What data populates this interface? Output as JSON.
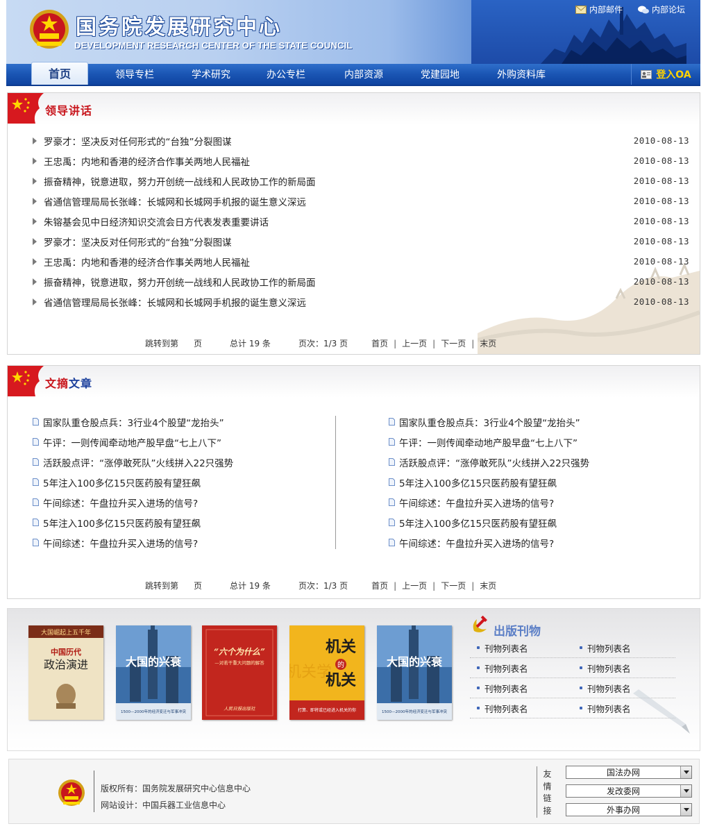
{
  "header": {
    "title": "国务院发展研究中心",
    "subtitle": "DEVELOPMENT RESEARCH CENTER OF THE STATE COUNCIL",
    "top_links": [
      {
        "icon": "mail-icon",
        "label": "内部邮件"
      },
      {
        "icon": "forum-icon",
        "label": "内部论坛"
      }
    ]
  },
  "nav": {
    "items": [
      "首页",
      "领导专栏",
      "学术研究",
      "办公专栏",
      "内部资源",
      "党建园地",
      "外购资料库"
    ],
    "active_index": 0,
    "login_label": "登入OA"
  },
  "leaders": {
    "title_a": "领导",
    "title_b": "讲话",
    "items": [
      {
        "title": "罗豪才：坚决反对任何形式的“台独”分裂图谋",
        "date": "2010-08-13"
      },
      {
        "title": "王忠禹：内地和香港的经济合作事关两地人民福祉",
        "date": "2010-08-13"
      },
      {
        "title": "振奋精神，锐意进取，努力开创统一战线和人民政协工作的新局面",
        "date": "2010-08-13"
      },
      {
        "title": "省通信管理局局长张峰：长城网和长城网手机报的诞生意义深远",
        "date": "2010-08-13"
      },
      {
        "title": "朱镕基会见中日经济知识交流会日方代表发表重要讲话",
        "date": "2010-08-13"
      },
      {
        "title": "罗豪才：坚决反对任何形式的“台独”分裂图谋",
        "date": "2010-08-13"
      },
      {
        "title": "王忠禹：内地和香港的经济合作事关两地人民福祉",
        "date": "2010-08-13"
      },
      {
        "title": "振奋精神，锐意进取，努力开创统一战线和人民政协工作的新局面",
        "date": "2010-08-13"
      },
      {
        "title": "省通信管理局局长张峰：长城网和长城网手机报的诞生意义深远",
        "date": "2010-08-13"
      }
    ],
    "pager": {
      "jump_a": "跳转到第",
      "jump_b": "页",
      "total": "总计 19 条",
      "pages": "页次：1/3 页",
      "first": "首页",
      "prev": "上一页",
      "next": "下一页",
      "last": "末页"
    }
  },
  "digest": {
    "title_a": "文摘",
    "title_b": "文章",
    "left": [
      "国家队重仓股点兵：3行业4个股望“龙抬头”",
      "午评：一则传闻牵动地产股早盘“七上八下”",
      "活跃股点评：“涨停敢死队”火线拼入22只强势",
      "5年注入100多亿15只医药股有望狂飙",
      "午间综述：午盘拉升买入进场的信号?",
      "5年注入100多亿15只医药股有望狂飙",
      "午间综述：午盘拉升买入进场的信号?"
    ],
    "right": [
      "国家队重仓股点兵：3行业4个股望“龙抬头”",
      "午评：一则传闻牵动地产股早盘“七上八下”",
      "活跃股点评：“涨停敢死队”火线拼入22只强势",
      "5年注入100多亿15只医药股有望狂飙",
      "午间综述：午盘拉升买入进场的信号?",
      "5年注入100多亿15只医药股有望狂飙",
      "午间综述：午盘拉升买入进场的信号?"
    ],
    "pager": {
      "jump_a": "跳转到第",
      "jump_b": "页",
      "total": "总计 19 条",
      "pages": "页次：1/3 页",
      "first": "首页",
      "prev": "上一页",
      "next": "下一页",
      "last": "末页"
    }
  },
  "publications": {
    "title": "出版刊物",
    "books": [
      {
        "top": "大国崛起上五千年",
        "main": "中国历代",
        "sub": "政治演进"
      },
      {
        "main": "大国的兴衰",
        "caption": "1500—2000年的经济变迁与军事冲突"
      },
      {
        "main": "“六个为什么”",
        "sub": "—对若干重大问题的解答",
        "foot": "人民日报出版社"
      },
      {
        "main_a": "机关",
        "mid": "的",
        "main_b": "机关",
        "side": "机关学",
        "foot": "打算、即将或已经进入机关的你"
      },
      {
        "main": "大国的兴衰",
        "caption": "1500—2000年的经济变迁与军事冲突"
      }
    ],
    "items": [
      "刊物列表名",
      "刊物列表名",
      "刊物列表名",
      "刊物列表名",
      "刊物列表名",
      "刊物列表名",
      "刊物列表名",
      "刊物列表名"
    ]
  },
  "footer": {
    "copyright": "版权所有：国务院发展研究中心信息中心",
    "design": "网站设计：中国兵器工业信息中心",
    "links_label": [
      "友",
      "情",
      "链",
      "接"
    ],
    "selects": [
      "国法办网",
      "发改委网",
      "外事办网"
    ]
  },
  "colors": {
    "brand_blue": "#1a55b3",
    "title_red": "#c8161d",
    "title_blue": "#1b3f9c",
    "login_yellow": "#ffd200"
  }
}
